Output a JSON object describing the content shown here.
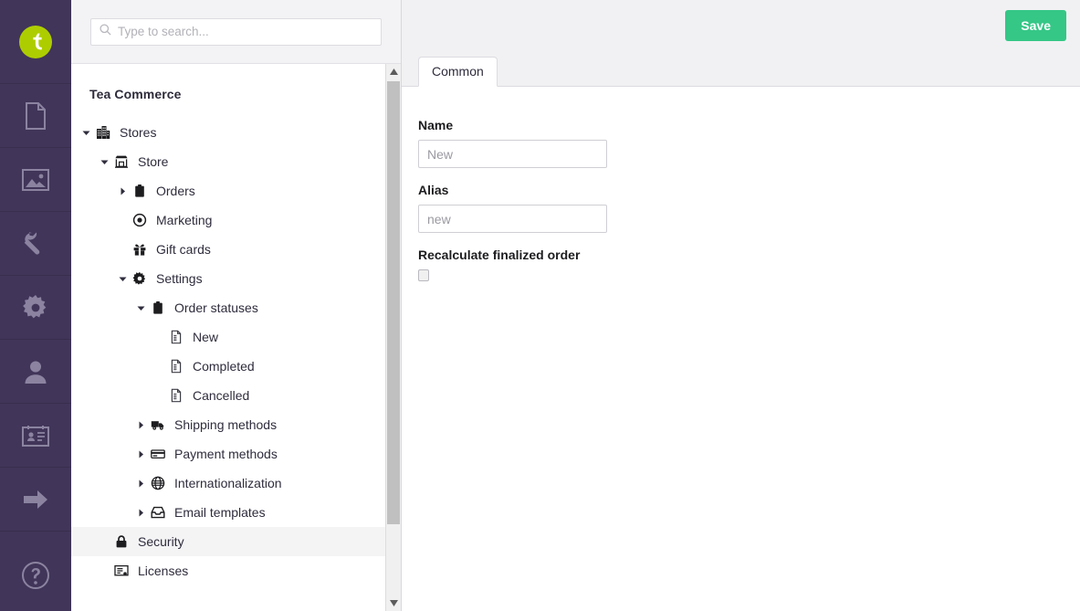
{
  "rail": {
    "logo": {
      "icon": "umbraco-logo-icon",
      "brand_color": "#aecd00"
    },
    "items": [
      {
        "icon": "content-document-icon",
        "name": "content"
      },
      {
        "icon": "media-image-icon",
        "name": "media"
      },
      {
        "icon": "settings-wrench-icon",
        "name": "settings"
      },
      {
        "icon": "packages-gear-icon",
        "name": "packages"
      },
      {
        "icon": "users-person-icon",
        "name": "users"
      },
      {
        "icon": "members-idcard-icon",
        "name": "members"
      },
      {
        "icon": "commerce-arrow-icon",
        "name": "commerce"
      }
    ],
    "help": {
      "icon": "help-question-icon",
      "name": "help"
    },
    "background_color": "#413559"
  },
  "search": {
    "placeholder": "Type to search...",
    "value": "",
    "icon": "search-icon"
  },
  "tree": {
    "title": "Tea Commerce",
    "nodes": [
      {
        "label": "Stores",
        "icon": "buildings-icon",
        "caret": "expanded",
        "depth": 0,
        "highlight": false
      },
      {
        "label": "Store",
        "icon": "shop-icon",
        "caret": "expanded",
        "depth": 1,
        "highlight": false
      },
      {
        "label": "Orders",
        "icon": "clipboard-icon",
        "caret": "collapsed",
        "depth": 2,
        "highlight": false
      },
      {
        "label": "Marketing",
        "icon": "bullseye-icon",
        "caret": "none",
        "depth": 2,
        "highlight": false
      },
      {
        "label": "Gift cards",
        "icon": "gift-icon",
        "caret": "none",
        "depth": 2,
        "highlight": false
      },
      {
        "label": "Settings",
        "icon": "gear-icon",
        "caret": "expanded",
        "depth": 2,
        "highlight": false
      },
      {
        "label": "Order statuses",
        "icon": "clipboard-icon",
        "caret": "expanded",
        "depth": 3,
        "highlight": false
      },
      {
        "label": "New",
        "icon": "document-icon",
        "caret": "none",
        "depth": 4,
        "highlight": false
      },
      {
        "label": "Completed",
        "icon": "document-icon",
        "caret": "none",
        "depth": 4,
        "highlight": false
      },
      {
        "label": "Cancelled",
        "icon": "document-icon",
        "caret": "none",
        "depth": 4,
        "highlight": false
      },
      {
        "label": "Shipping methods",
        "icon": "truck-icon",
        "caret": "collapsed",
        "depth": 3,
        "highlight": false
      },
      {
        "label": "Payment methods",
        "icon": "creditcard-icon",
        "caret": "collapsed",
        "depth": 3,
        "highlight": false
      },
      {
        "label": "Internationalization",
        "icon": "globe-icon",
        "caret": "collapsed",
        "depth": 3,
        "highlight": false
      },
      {
        "label": "Email templates",
        "icon": "inbox-icon",
        "caret": "collapsed",
        "depth": 3,
        "highlight": false
      },
      {
        "label": "Security",
        "icon": "lock-icon",
        "caret": "none",
        "depth": 1,
        "highlight": true
      },
      {
        "label": "Licenses",
        "icon": "license-icon",
        "caret": "none",
        "depth": 1,
        "highlight": false
      }
    ]
  },
  "header": {
    "save_label": "Save",
    "save_color": "#35c786"
  },
  "tabs": [
    {
      "label": "Common",
      "active": true
    }
  ],
  "form": {
    "name": {
      "label": "Name",
      "placeholder": "New",
      "value": ""
    },
    "alias": {
      "label": "Alias",
      "placeholder": "new",
      "value": ""
    },
    "recalculate": {
      "label": "Recalculate finalized order",
      "checked": false
    }
  }
}
